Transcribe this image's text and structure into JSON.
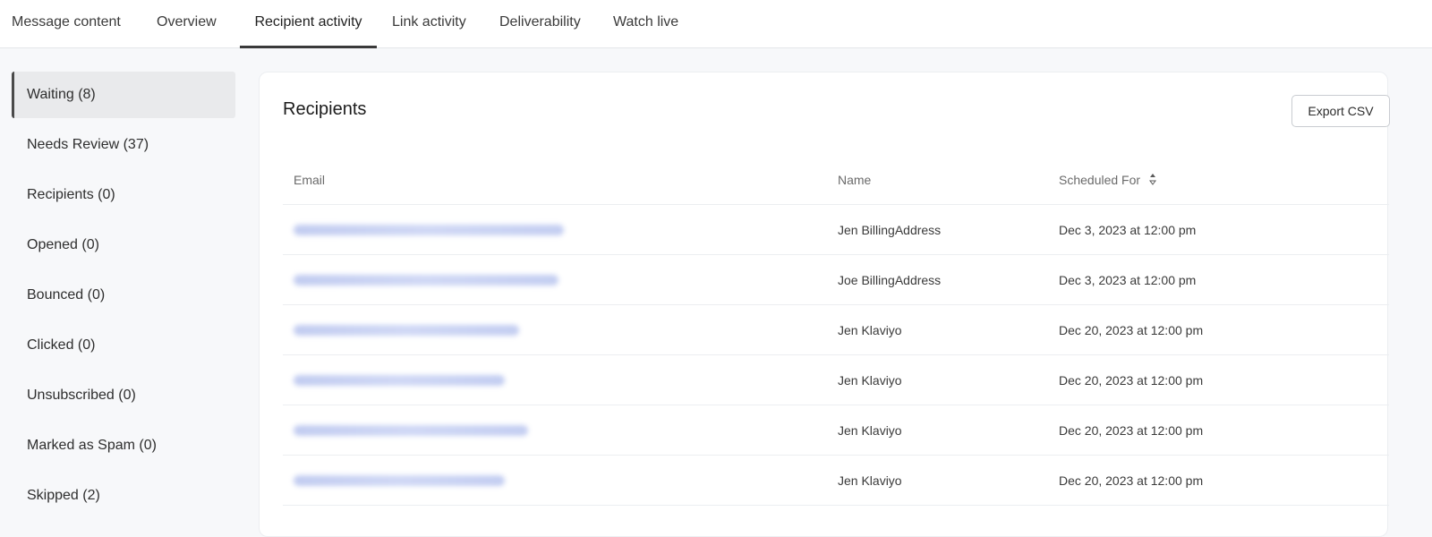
{
  "tabs": [
    {
      "label": "Message content"
    },
    {
      "label": "Overview"
    },
    {
      "label": "Recipient activity"
    },
    {
      "label": "Link activity"
    },
    {
      "label": "Deliverability"
    },
    {
      "label": "Watch live"
    }
  ],
  "sidebar": {
    "items": [
      {
        "label": "Waiting (8)"
      },
      {
        "label": "Needs Review (37)"
      },
      {
        "label": "Recipients (0)"
      },
      {
        "label": "Opened (0)"
      },
      {
        "label": "Bounced (0)"
      },
      {
        "label": "Clicked (0)"
      },
      {
        "label": "Unsubscribed (0)"
      },
      {
        "label": "Marked as Spam (0)"
      },
      {
        "label": "Skipped (2)"
      }
    ]
  },
  "main": {
    "title": "Recipients",
    "export_label": "Export CSV",
    "columns": {
      "email": "Email",
      "name": "Name",
      "scheduled": "Scheduled For"
    },
    "rows": [
      {
        "name": "Jen BillingAddress",
        "scheduled": "Dec 3, 2023 at 12:00 pm"
      },
      {
        "name": "Joe BillingAddress",
        "scheduled": "Dec 3, 2023 at 12:00 pm"
      },
      {
        "name": "Jen Klaviyo",
        "scheduled": "Dec 20, 2023 at 12:00 pm"
      },
      {
        "name": "Jen Klaviyo",
        "scheduled": "Dec 20, 2023 at 12:00 pm"
      },
      {
        "name": "Jen Klaviyo",
        "scheduled": "Dec 20, 2023 at 12:00 pm"
      },
      {
        "name": "Jen Klaviyo",
        "scheduled": "Dec 20, 2023 at 12:00 pm"
      }
    ]
  },
  "icons": {
    "sort": "sort-icon"
  }
}
